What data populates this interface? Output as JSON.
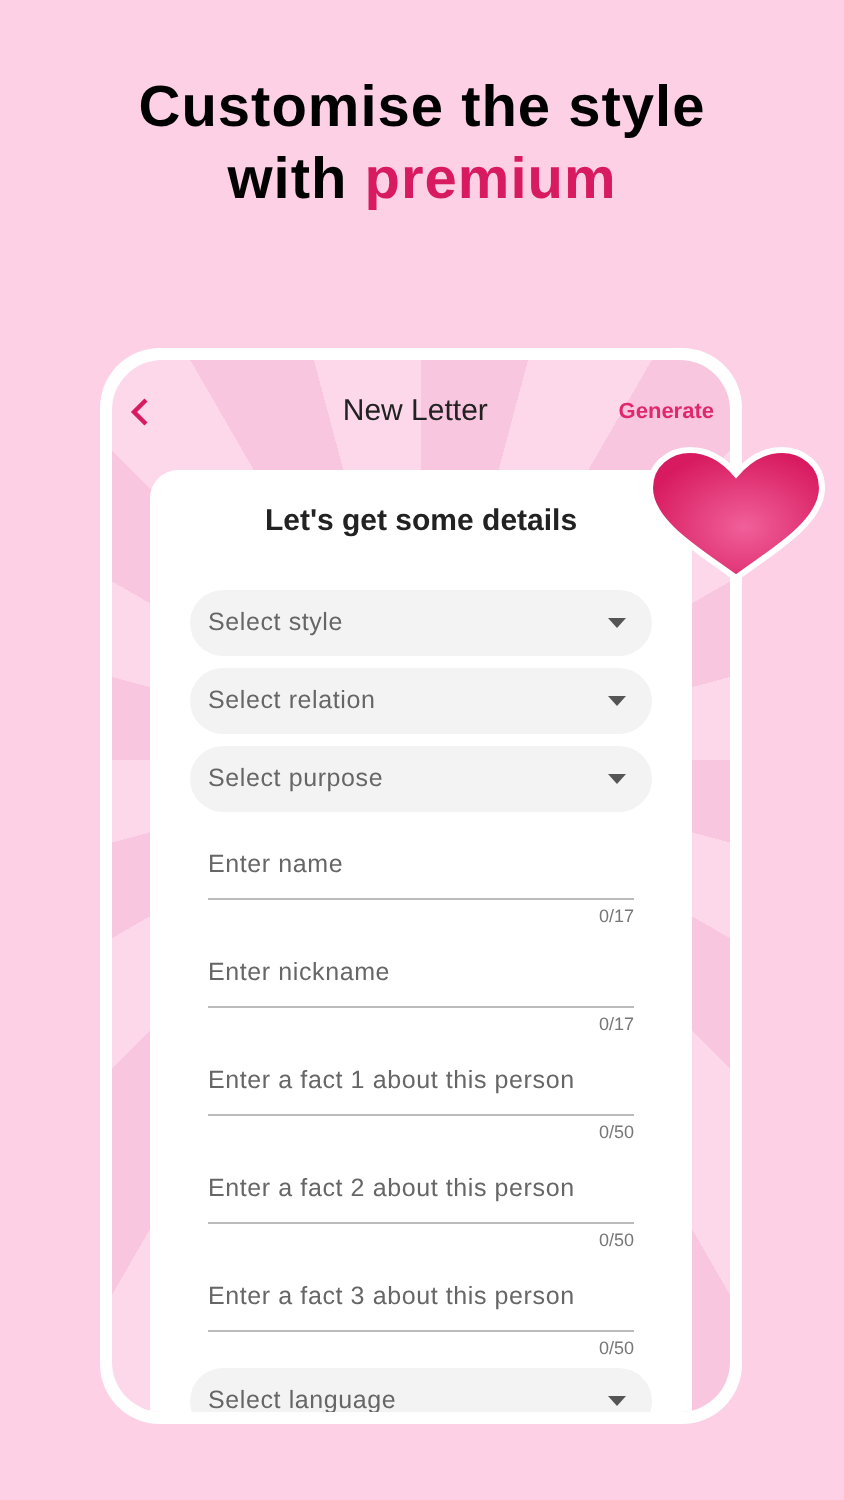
{
  "headline": {
    "text": "Customise the style with",
    "highlight": "premium"
  },
  "header": {
    "title": "New Letter",
    "action": "Generate"
  },
  "card": {
    "title": "Let's get some details",
    "fields": [
      {
        "kind": "dropdown",
        "placeholder": "Select style"
      },
      {
        "kind": "dropdown",
        "placeholder": "Select relation"
      },
      {
        "kind": "dropdown",
        "placeholder": "Select purpose"
      },
      {
        "kind": "text",
        "placeholder": "Enter name",
        "counter": "0/17"
      },
      {
        "kind": "text",
        "placeholder": "Enter nickname",
        "counter": "0/17"
      },
      {
        "kind": "text",
        "placeholder": "Enter a fact 1 about this person",
        "counter": "0/50"
      },
      {
        "kind": "text",
        "placeholder": "Enter a fact 2 about this person",
        "counter": "0/50"
      },
      {
        "kind": "text",
        "placeholder": "Enter a fact 3 about this person",
        "counter": "0/50"
      },
      {
        "kind": "dropdown",
        "placeholder": "Select language"
      }
    ]
  }
}
